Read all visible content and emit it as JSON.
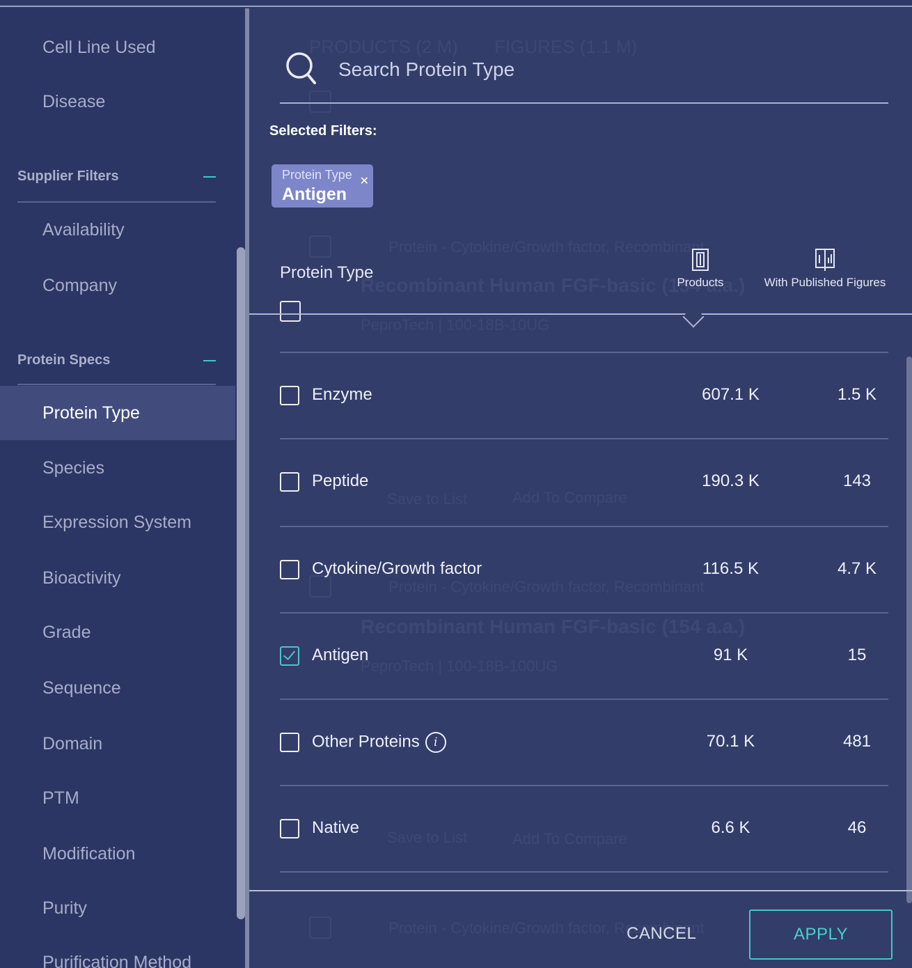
{
  "sidebar": {
    "items_top": [
      "Cell Line Used",
      "Disease"
    ],
    "supplier_section": "Supplier Filters",
    "supplier_items": [
      "Availability",
      "Company"
    ],
    "protein_section": "Protein Specs",
    "protein_items": [
      "Protein Type",
      "Species",
      "Expression System",
      "Bioactivity",
      "Grade",
      "Sequence",
      "Domain",
      "PTM",
      "Modification",
      "Purity",
      "Purification Method"
    ],
    "active_item": "Protein Type"
  },
  "background": {
    "tabs": [
      "PRODUCTS (2 M)",
      "FIGURES (1.1 M)"
    ],
    "category_text": "Protein - Cytokine/Growth factor, Recombinant",
    "product_title_1": "Recombinant Human FGF-basic (154 a.a.)",
    "product_sub_1": "PeproTech | 100-18B-10UG",
    "product_title_2": "Recombinant Human FGF-basic (154 a.a.)",
    "product_sub_2": "PeproTech | 100-18B-100UG",
    "save_to_list": "Save to List",
    "add_to_compare": "Add To Compare"
  },
  "search": {
    "placeholder": "Search Protein Type"
  },
  "selected_filters": {
    "label": "Selected Filters:",
    "chips": [
      {
        "category": "Protein Type",
        "value": "Antigen"
      }
    ]
  },
  "table": {
    "title": "Protein Type",
    "col_products": "Products",
    "col_figures": "With Published Figures",
    "rows": [
      {
        "label": "Enzyme",
        "products": "607.1 K",
        "figures": "1.5 K",
        "checked": false
      },
      {
        "label": "Peptide",
        "products": "190.3 K",
        "figures": "143",
        "checked": false
      },
      {
        "label": "Cytokine/Growth factor",
        "products": "116.5 K",
        "figures": "4.7 K",
        "checked": false
      },
      {
        "label": "Antigen",
        "products": "91 K",
        "figures": "15",
        "checked": true
      },
      {
        "label": "Other Proteins",
        "products": "70.1 K",
        "figures": "481",
        "checked": false,
        "info_icon": "info-icon"
      },
      {
        "label": "Native",
        "products": "6.6 K",
        "figures": "46",
        "checked": false
      }
    ]
  },
  "footer": {
    "cancel": "CANCEL",
    "apply": "APPLY"
  },
  "colors": {
    "accent": "#46c6c1",
    "chip": "#7c86c9",
    "sidebar_active": "#414c7d",
    "panel": "#323d6a"
  }
}
